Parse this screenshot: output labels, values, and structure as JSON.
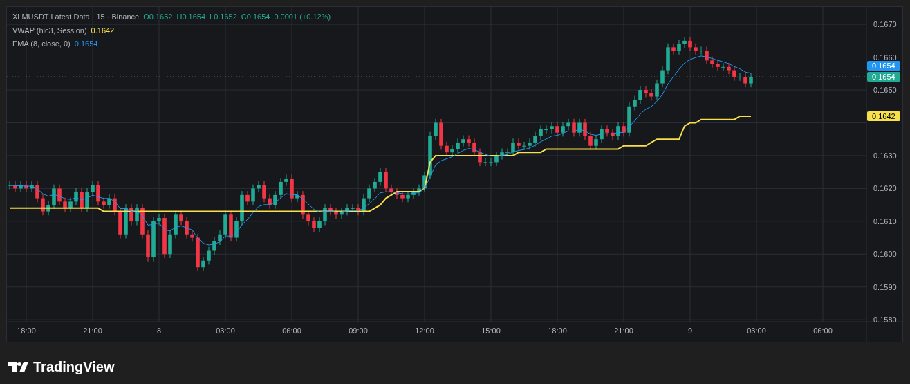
{
  "legend": {
    "symbol": "XLMUSDT Latest Data · 15 · Binance",
    "ohlc": [
      {
        "label": "O",
        "value": "0.1652"
      },
      {
        "label": "H",
        "value": "0.1654"
      },
      {
        "label": "L",
        "value": "0.1652"
      },
      {
        "label": "C",
        "value": "0.1654"
      }
    ],
    "change": "0.0001 (+0.12%)",
    "indicators": [
      {
        "kind": "vwap",
        "name": "VWAP (hlc3, Session)",
        "value": "0.1642",
        "color": "#f7e04b"
      },
      {
        "kind": "ema",
        "name": "EMA (8, close, 0)",
        "value": "0.1654",
        "color": "#2196f3"
      }
    ]
  },
  "price_axis": {
    "labels": [
      "0.1670",
      "0.1660",
      "0.1650",
      "0.1630",
      "0.1620",
      "0.1610",
      "0.1600",
      "0.1590",
      "0.1580"
    ]
  },
  "time_axis": {
    "labels": [
      "18:00",
      "21:00",
      "8",
      "03:00",
      "06:00",
      "09:00",
      "12:00",
      "15:00",
      "18:00",
      "21:00",
      "9",
      "03:00",
      "06:00"
    ]
  },
  "price_badges": [
    {
      "kind": "ema",
      "text": "0.1654",
      "color": "#2196f3"
    },
    {
      "kind": "close",
      "text": "0.1654",
      "color": "#22ab94"
    },
    {
      "kind": "vwap",
      "text": "0.1642",
      "color": "#f7e04b"
    }
  ],
  "brand": "TradingView"
}
